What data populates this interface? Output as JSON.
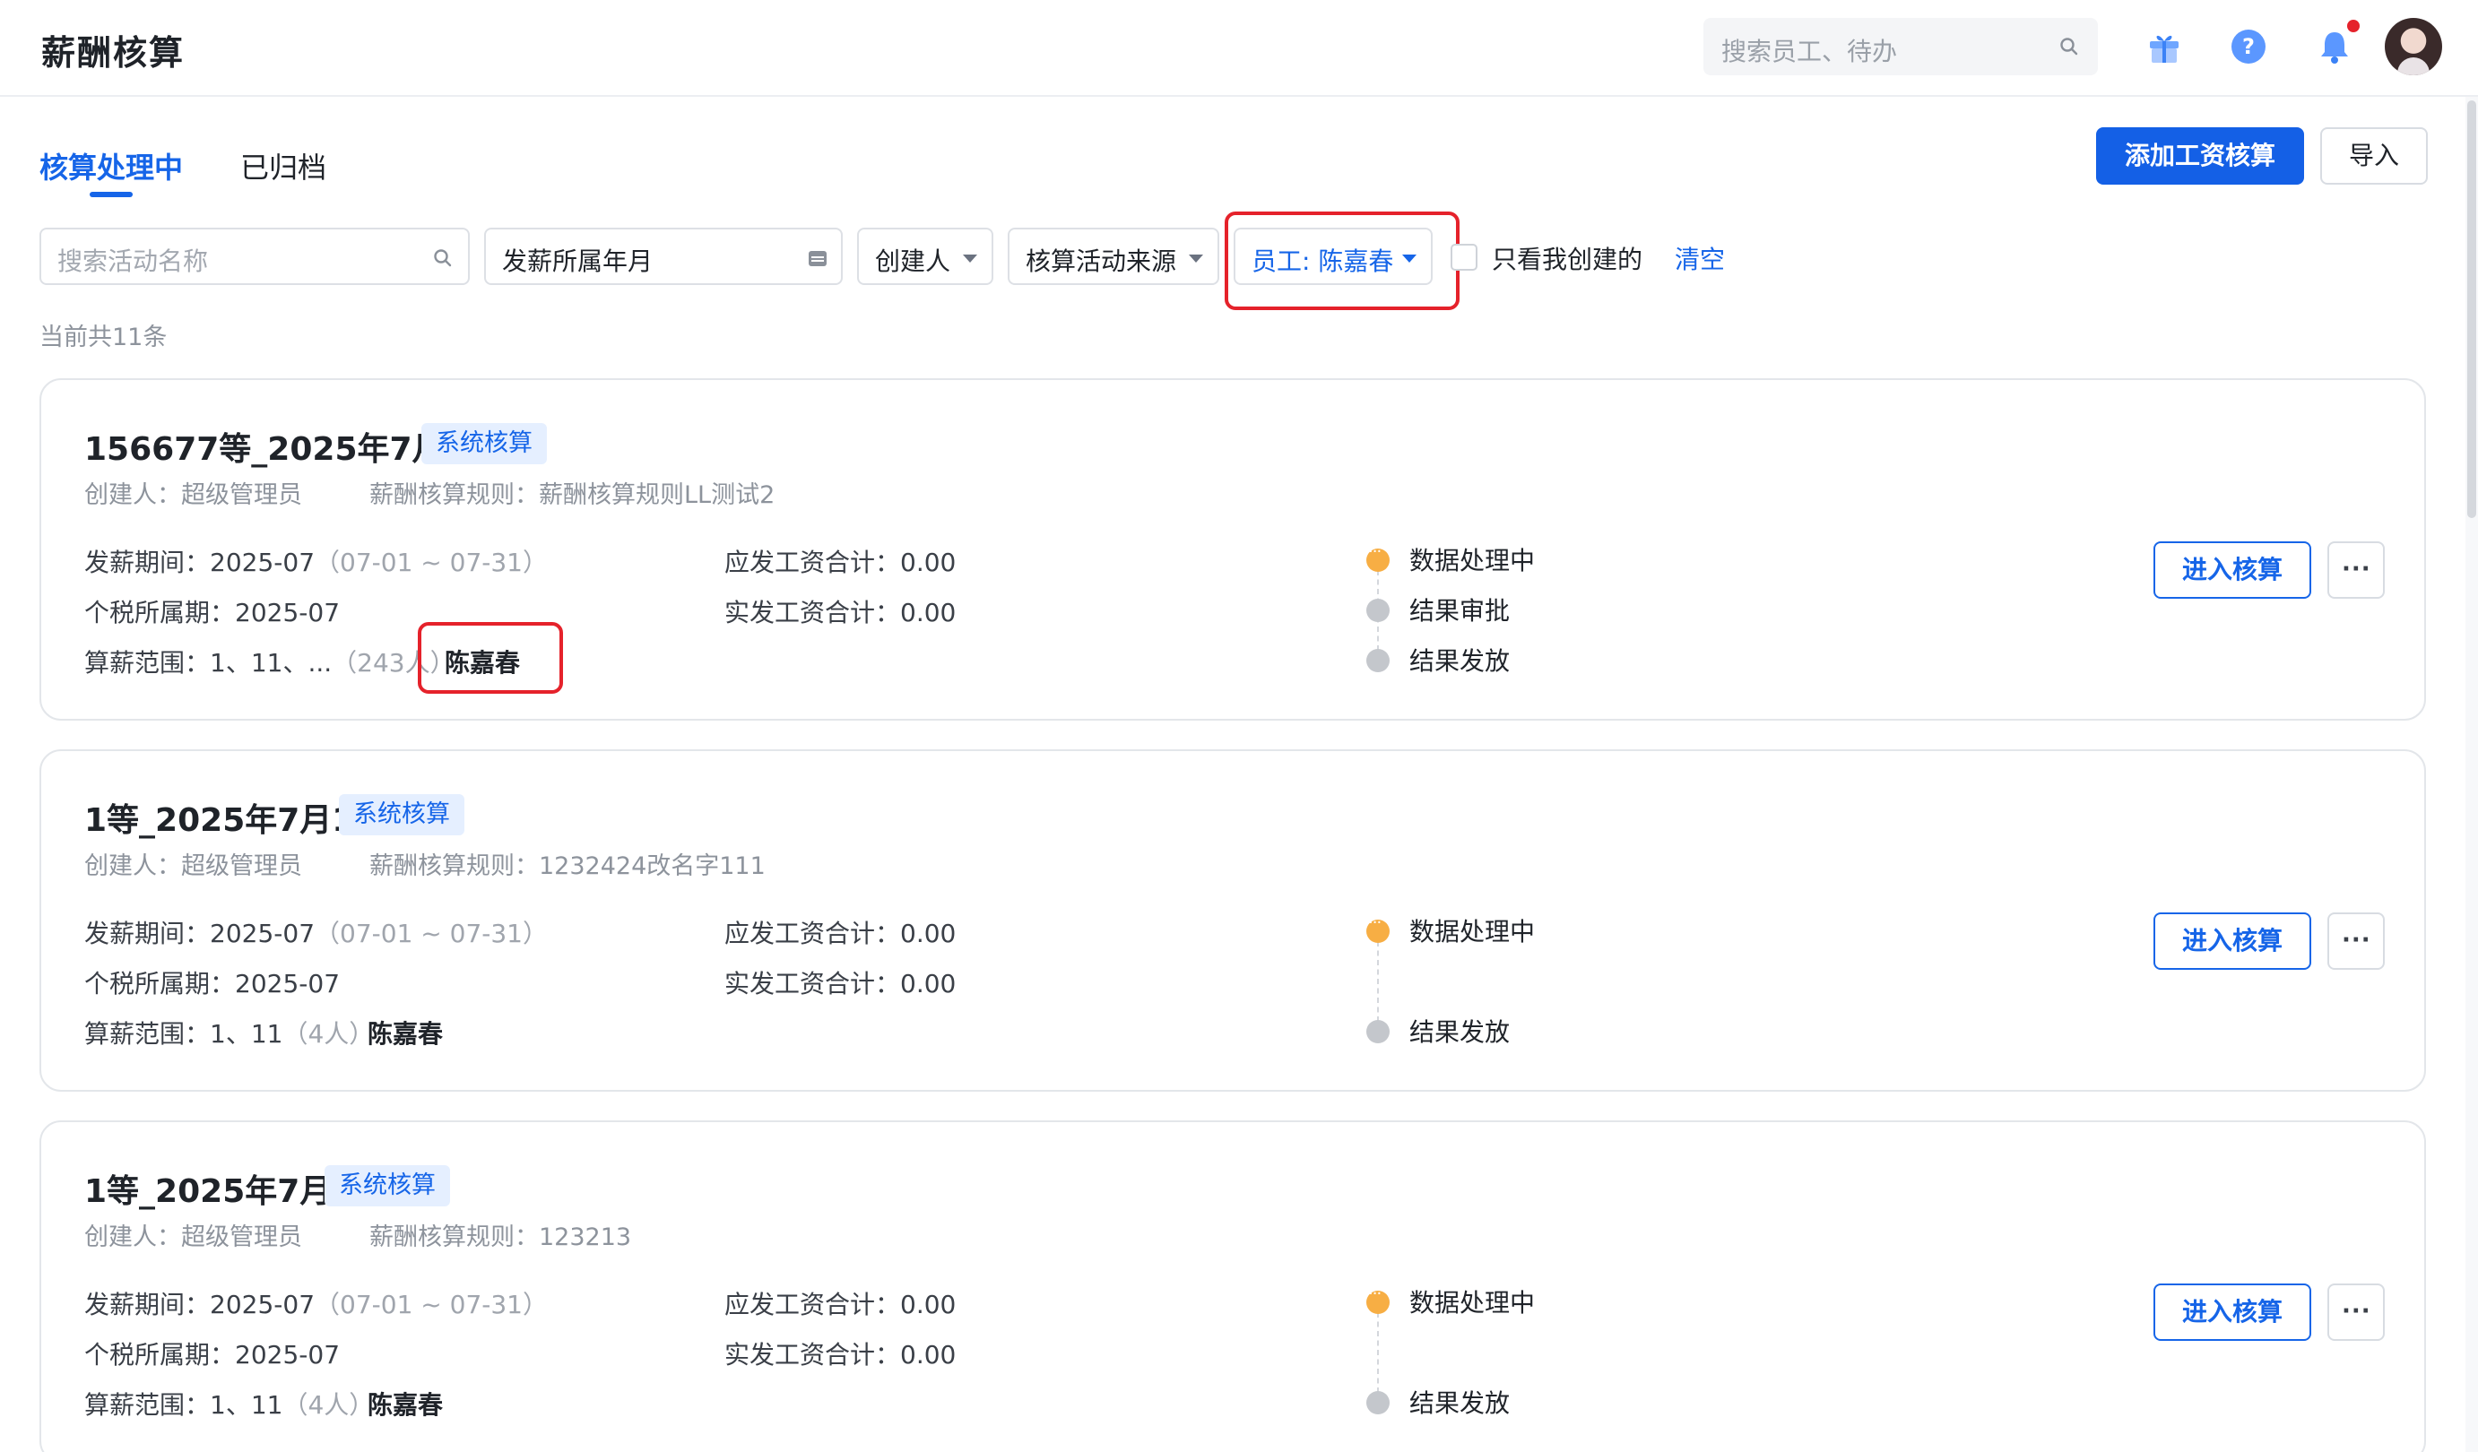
{
  "header": {
    "title": "薪酬核算",
    "search_placeholder": "搜索员工、待办",
    "icons": [
      "gift-icon",
      "help-icon",
      "bell-icon"
    ],
    "notification_dot_color": "#e5222b"
  },
  "tabs": [
    {
      "label": "核算处理中",
      "active": true
    },
    {
      "label": "已归档",
      "active": false
    }
  ],
  "actions": {
    "add_label": "添加工资核算",
    "import_label": "导入"
  },
  "filters": {
    "search_placeholder": "搜索活动名称",
    "month_placeholder": "发薪所属年月",
    "creator_label": "创建人",
    "source_label": "核算活动来源",
    "employee_label": "员工: 陈嘉春",
    "only_mine_label": "只看我创建的",
    "clear_label": "清空"
  },
  "count_text": "当前共11条",
  "cards": [
    {
      "title": "156677等_2025年7月",
      "tag": "系统核算",
      "creator": "创建人：超级管理员",
      "rule": "薪酬核算规则：薪酬核算规则LL测试2",
      "pay_period_label": "发薪期间：",
      "pay_period": "2025-07",
      "pay_range": "（07-01 ~ 07-31）",
      "tax_period_label": "个税所属期：",
      "tax_period": "2025-07",
      "scope_label": "算薪范围：",
      "scope": "1、11、...",
      "scope_count": "（243人）",
      "employee": "陈嘉春",
      "gross_label": "应发工资合计：",
      "gross": "0.00",
      "net_label": "实发工资合计：",
      "net": "0.00",
      "steps": [
        {
          "label": "数据处理中",
          "state": "active"
        },
        {
          "label": "结果审批",
          "state": "todo"
        },
        {
          "label": "结果发放",
          "state": "todo"
        }
      ],
      "enter_label": "进入核算",
      "more_label": "···"
    },
    {
      "title": "1等_2025年7月1",
      "tag": "系统核算",
      "creator": "创建人：超级管理员",
      "rule": "薪酬核算规则：1232424改名字111",
      "pay_period_label": "发薪期间：",
      "pay_period": "2025-07",
      "pay_range": "（07-01 ~ 07-31）",
      "tax_period_label": "个税所属期：",
      "tax_period": "2025-07",
      "scope_label": "算薪范围：",
      "scope": "1、11",
      "scope_count": "（4人）",
      "employee": "陈嘉春",
      "gross_label": "应发工资合计：",
      "gross": "0.00",
      "net_label": "实发工资合计：",
      "net": "0.00",
      "steps": [
        {
          "label": "数据处理中",
          "state": "active"
        },
        {
          "label": "结果发放",
          "state": "todo"
        }
      ],
      "enter_label": "进入核算",
      "more_label": "···"
    },
    {
      "title": "1等_2025年7月",
      "tag": "系统核算",
      "creator": "创建人：超级管理员",
      "rule": "薪酬核算规则：123213",
      "pay_period_label": "发薪期间：",
      "pay_period": "2025-07",
      "pay_range": "（07-01 ~ 07-31）",
      "tax_period_label": "个税所属期：",
      "tax_period": "2025-07",
      "scope_label": "算薪范围：",
      "scope": "1、11",
      "scope_count": "（4人）",
      "employee": "陈嘉春",
      "gross_label": "应发工资合计：",
      "gross": "0.00",
      "net_label": "实发工资合计：",
      "net": "0.00",
      "steps": [
        {
          "label": "数据处理中",
          "state": "active"
        },
        {
          "label": "结果发放",
          "state": "todo"
        }
      ],
      "enter_label": "进入核算",
      "more_label": "···"
    }
  ]
}
